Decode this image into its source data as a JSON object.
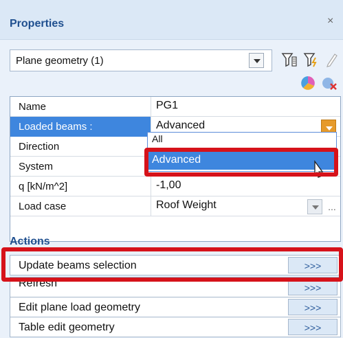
{
  "panel": {
    "title": "Properties",
    "close_glyph": "×"
  },
  "selector": {
    "value": "Plane geometry (1)"
  },
  "properties": [
    {
      "name": "Name",
      "value": "PG1"
    },
    {
      "name": "Loaded beams :",
      "value": "Advanced"
    },
    {
      "name": "Direction",
      "value": ""
    },
    {
      "name": "System",
      "value": ""
    },
    {
      "name": "q [kN/m^2]",
      "value": "-1,00"
    },
    {
      "name": "Load case",
      "value": "Roof Weight"
    }
  ],
  "dropdown": {
    "options": [
      "All",
      "Advanced"
    ],
    "selected": "Advanced"
  },
  "actions": {
    "title": "Actions",
    "items": [
      {
        "label": "Update beams selection",
        "button": ">>>"
      },
      {
        "label": "Refresh",
        "button": ">>>"
      },
      {
        "label": "Edit plane load geometry",
        "button": ">>>"
      },
      {
        "label": "Table edit geometry",
        "button": ">>>"
      }
    ]
  },
  "colors": {
    "highlight_red": "#d6121a",
    "selection_blue": "#3e86de",
    "dropdown_arrow_orange": "#e69a2a"
  },
  "load_case_dots": "..."
}
